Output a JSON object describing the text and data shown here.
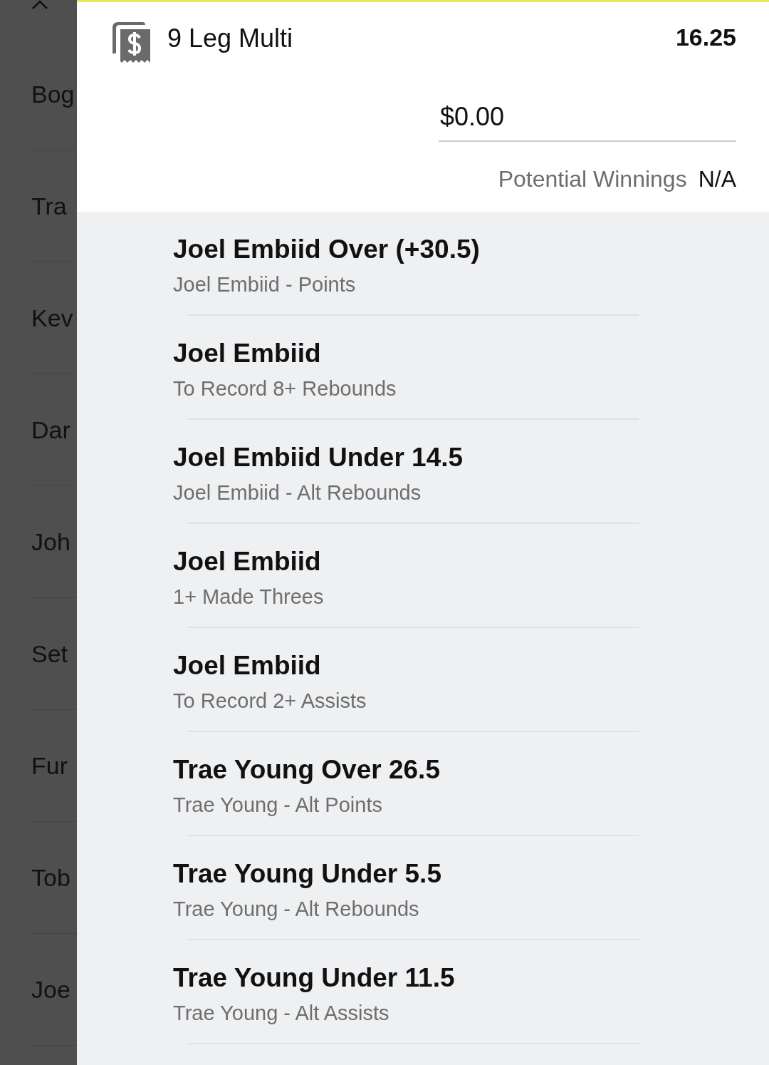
{
  "background_list": {
    "items": [
      {
        "label": "Bog"
      },
      {
        "label": "Tra"
      },
      {
        "label": "Kev"
      },
      {
        "label": "Dar"
      },
      {
        "label": "Joh"
      },
      {
        "label": "Set"
      },
      {
        "label": "Fur"
      },
      {
        "label": "Tob"
      },
      {
        "label": "Joe"
      }
    ]
  },
  "bet_slip": {
    "title": "9 Leg Multi",
    "odds": "16.25",
    "stake": {
      "value": "$0.00"
    },
    "potential_winnings": {
      "label": "Potential Winnings",
      "value": "N/A"
    },
    "legs": [
      {
        "selection": "Joel Embiid Over (+30.5)",
        "market": "Joel Embiid - Points"
      },
      {
        "selection": "Joel Embiid",
        "market": "To Record 8+ Rebounds"
      },
      {
        "selection": "Joel Embiid Under 14.5",
        "market": "Joel Embiid - Alt Rebounds"
      },
      {
        "selection": "Joel Embiid",
        "market": "1+ Made Threes"
      },
      {
        "selection": "Joel Embiid",
        "market": "To Record 2+ Assists"
      },
      {
        "selection": "Trae Young Over 26.5",
        "market": "Trae Young - Alt Points"
      },
      {
        "selection": "Trae Young Under 5.5",
        "market": "Trae Young - Alt Rebounds"
      },
      {
        "selection": "Trae Young Under 11.5",
        "market": "Trae Young - Alt Assists"
      }
    ]
  }
}
